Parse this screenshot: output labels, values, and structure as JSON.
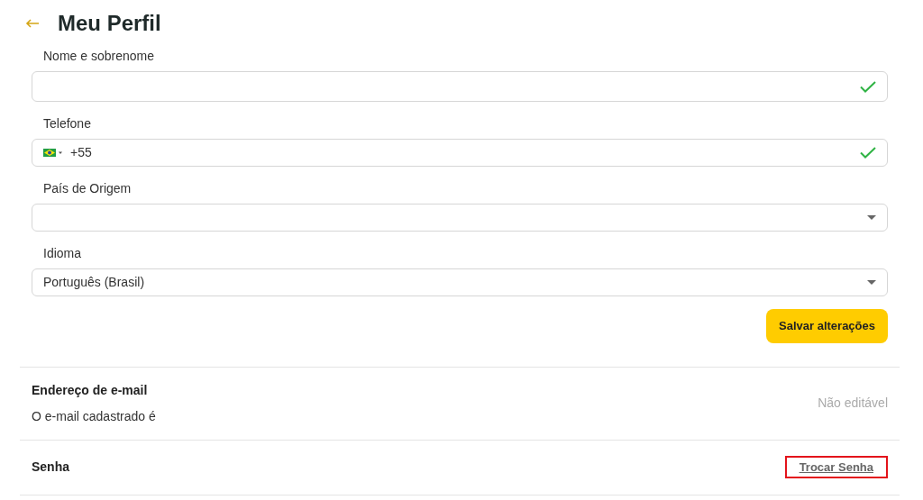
{
  "header": {
    "title": "Meu Perfil"
  },
  "fields": [
    {
      "kind": "text",
      "label": "Nome e sobrenome",
      "valid": true
    },
    {
      "kind": "phone",
      "label": "Telefone",
      "value": "+55",
      "valid": true
    },
    {
      "kind": "select",
      "label": "País de Origem",
      "valid": false
    },
    {
      "kind": "select",
      "label": "Idioma",
      "value": "Português (Brasil)",
      "valid": false
    }
  ],
  "save_button": "Salvar alterações",
  "sections": [
    {
      "kind": "note",
      "title": "Endereço de e-mail",
      "description": "O e-mail cadastrado é",
      "note": "Não editável"
    },
    {
      "kind": "link",
      "title": "Senha",
      "link": "Trocar Senha",
      "highlighted": true
    }
  ]
}
